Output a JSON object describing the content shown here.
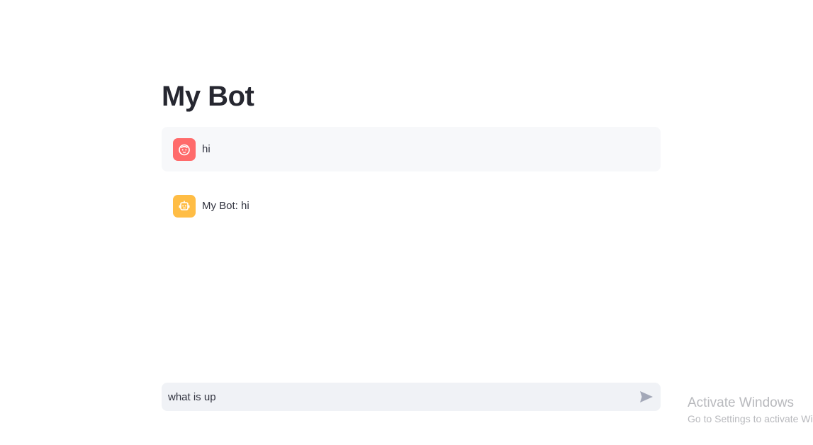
{
  "app": {
    "title": "My Bot"
  },
  "messages": [
    {
      "role": "user",
      "avatar_icon": "user-face-icon",
      "avatar_color": "#ff6b6b",
      "text": "hi"
    },
    {
      "role": "assistant",
      "avatar_icon": "robot-icon",
      "avatar_color": "#ffbd45",
      "text": "My Bot: hi"
    }
  ],
  "chat_input": {
    "value": "what is up",
    "send_icon": "send-icon"
  },
  "watermark": {
    "title": "Activate Windows",
    "subtitle": "Go to Settings to activate Windows."
  }
}
